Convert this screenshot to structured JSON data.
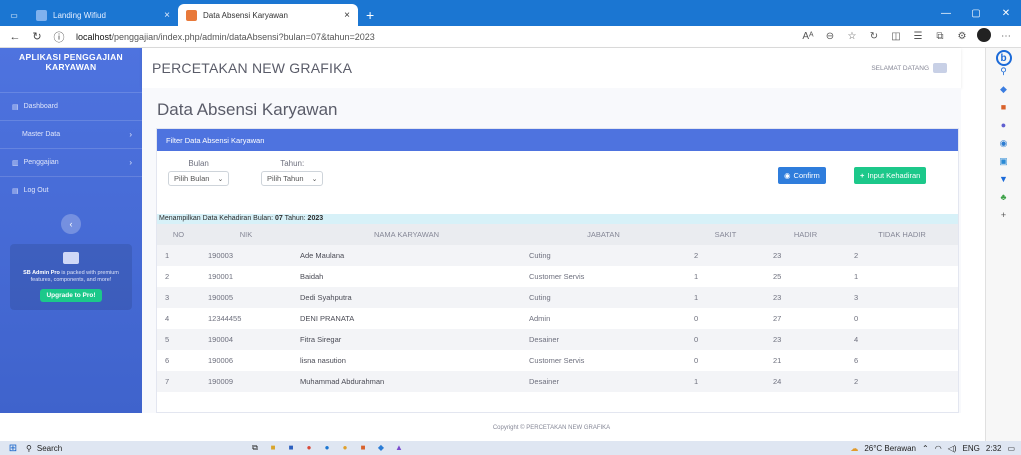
{
  "browser": {
    "tab_inactive": "Landing Wifiud",
    "tab_active": "Data Absensi Karyawan",
    "url_prefix": "localhost",
    "url_rest": "/penggajian/index.php/admin/dataAbsensi?bulan=07&tahun=2023"
  },
  "sidebar": {
    "brand": "APLIKASI PENGGAJIAN KARYAWAN",
    "items": [
      {
        "label": "Dashboard"
      },
      {
        "label": "Master Data"
      },
      {
        "label": "Penggajian"
      },
      {
        "label": "Log Out"
      }
    ],
    "promo_text_bold": "SB Admin Pro",
    "promo_text": "is packed with premium features, components, and more!",
    "promo_button": "Upgrade to Pro!"
  },
  "topbar": {
    "app_name": "PERCETAKAN NEW GRAFIKA",
    "greeting": "SELAMAT DATANG"
  },
  "page": {
    "title": "Data Absensi Karyawan"
  },
  "filter": {
    "header": "Filter Data Absensi Karyawan",
    "bulan_label": "Bulan",
    "bulan_value": "Pilih Bulan",
    "tahun_label": "Tahun:",
    "tahun_value": "Pilih Tahun",
    "confirm_button": "Confirm",
    "input_button": "Input Kehadiran"
  },
  "table": {
    "caption_prefix": "Menampilkan Data Kehadiran Bulan: ",
    "caption_month": "07",
    "caption_mid": " Tahun: ",
    "caption_year": "2023",
    "headers": [
      "NO",
      "NIK",
      "NAMA KARYAWAN",
      "JABATAN",
      "SAKIT",
      "HADIR",
      "TIDAK HADIR"
    ],
    "rows": [
      [
        "1",
        "190003",
        "Ade Maulana",
        "Cuting",
        "2",
        "23",
        "2"
      ],
      [
        "2",
        "190001",
        "Baidah",
        "Customer Servis",
        "1",
        "25",
        "1"
      ],
      [
        "3",
        "190005",
        "Dedi Syahputra",
        "Cuting",
        "1",
        "23",
        "3"
      ],
      [
        "4",
        "12344455",
        "DENI PRANATA",
        "Admin",
        "0",
        "27",
        "0"
      ],
      [
        "5",
        "190004",
        "Fitra Siregar",
        "Desainer",
        "0",
        "23",
        "4"
      ],
      [
        "6",
        "190006",
        "lisna nasution",
        "Customer Servis",
        "0",
        "21",
        "6"
      ],
      [
        "7",
        "190009",
        "Muhammad Abdurahman",
        "Desainer",
        "1",
        "24",
        "2"
      ]
    ]
  },
  "footer": {
    "copyright": "Copyright © PERCETAKAN NEW GRAFIKA"
  },
  "taskbar": {
    "search": "Search",
    "weather": "26°C Berawan",
    "lang": "ENG",
    "time": "2:32"
  },
  "colors": {
    "primary": "#4e73df",
    "success": "#1cc88a",
    "info": "#2f7ddc",
    "tab_bar": "#1b76d2"
  }
}
